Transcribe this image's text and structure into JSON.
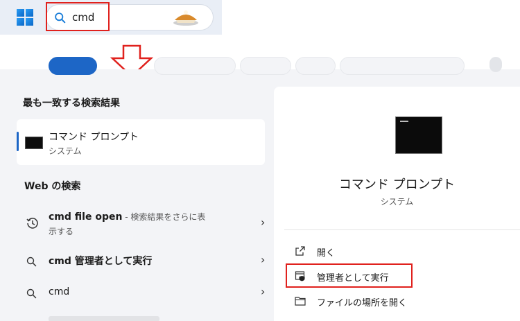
{
  "taskbar": {
    "search_value": "cmd"
  },
  "panel": {
    "best_match_title": "最も一致する検索結果",
    "best_match": {
      "name": "コマンド プロンプト",
      "type": "システム"
    },
    "web_title": "Web の検索",
    "web_results": [
      {
        "bold": "cmd file open",
        "rest": " - 検索結果をさらに表",
        "rest2": "示する",
        "icon": "history-icon"
      },
      {
        "bold": "cmd 管理者として実行",
        "icon": "search-icon"
      },
      {
        "bold": "cmd",
        "icon": "search-icon"
      }
    ]
  },
  "detail": {
    "app_name": "コマンド プロンプト",
    "app_type": "システム",
    "actions": [
      {
        "label": "開く",
        "icon": "open-external-icon"
      },
      {
        "label": "管理者として実行",
        "icon": "shield-icon"
      },
      {
        "label": "ファイルの場所を開く",
        "icon": "folder-icon"
      }
    ]
  },
  "colors": {
    "accent": "#1d66c6",
    "highlight_red": "#e0211d"
  }
}
